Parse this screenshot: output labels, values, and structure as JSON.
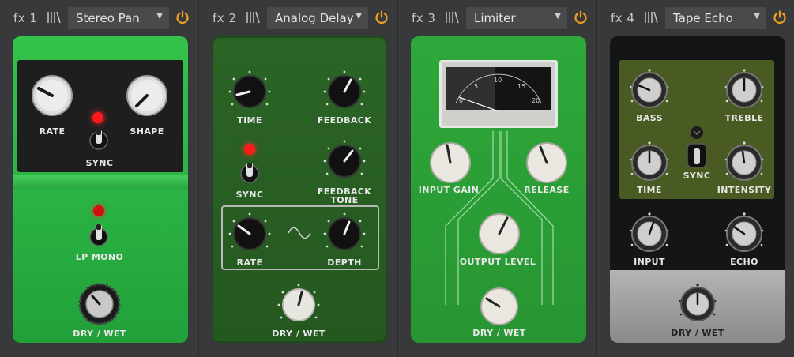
{
  "slots": [
    {
      "slot_label": "fx 1",
      "preset": "Stereo Pan",
      "labels": {
        "rate": "RATE",
        "shape": "SHAPE",
        "sync": "SYNC",
        "lp_mono": "LP MONO",
        "dry_wet": "DRY / WET"
      },
      "colors": {
        "pedal": "#2eb845",
        "panel": "#1e1e1f",
        "led_on": "#ff1a1a"
      }
    },
    {
      "slot_label": "fx 2",
      "preset": "Analog Delay",
      "labels": {
        "time": "TIME",
        "feedback": "FEEDBACK",
        "sync": "SYNC",
        "feedback_tone_1": "FEEDBACK",
        "feedback_tone_2": "TONE",
        "rate": "RATE",
        "depth": "DEPTH",
        "dry_wet": "DRY / WET"
      },
      "colors": {
        "pedal": "#2a5f24",
        "led_on": "#ff1a1a"
      }
    },
    {
      "slot_label": "fx 3",
      "preset": "Limiter",
      "labels": {
        "input_gain": "INPUT GAIN",
        "release": "RELEASE",
        "output_level": "OUTPUT LEVEL",
        "dry_wet": "DRY / WET"
      },
      "meter_ticks": [
        "0",
        "5",
        "10",
        "15",
        "20"
      ],
      "colors": {
        "pedal": "#2aa036"
      }
    },
    {
      "slot_label": "fx 4",
      "preset": "Tape Echo",
      "labels": {
        "bass": "BASS",
        "treble": "TREBLE",
        "time": "TIME",
        "sync": "SYNC",
        "intensity": "INTENSITY",
        "input": "INPUT",
        "echo": "ECHO",
        "dry_wet": "DRY / WET"
      },
      "colors": {
        "pedal": "#141515",
        "panel": "#4a5a23"
      }
    }
  ],
  "icons": {
    "power": "power-icon",
    "drag": "drag-handle-icon",
    "dropdown": "chevron-down-icon"
  },
  "accent": "#f0a020"
}
